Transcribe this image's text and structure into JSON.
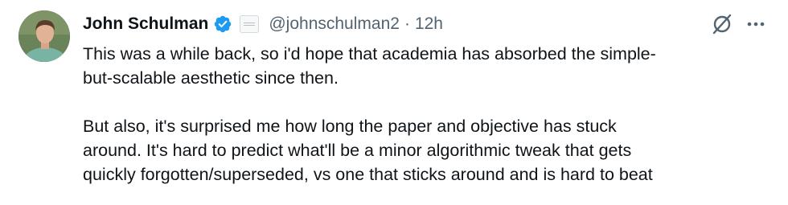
{
  "author": {
    "name": "John Schulman",
    "handle": "@johnschulman2",
    "separator": "·",
    "timestamp": "12h",
    "verified": true,
    "avatar_icon": "profile-photo"
  },
  "actions": {
    "grok_icon": "grok-icon",
    "more_icon": "more-options-icon"
  },
  "tweet": {
    "paragraphs": [
      "This was a while back, so i'd hope that academia has absorbed the simple-\nbut-scalable aesthetic since then.",
      "But also, it's surprised me how long the paper and objective has stuck\naround. It's hard to predict what'll be a minor algorithmic tweak that gets\nquickly forgotten/superseded, vs one that sticks around and is hard to beat"
    ]
  },
  "colors": {
    "text": "#0f1419",
    "secondary_text": "#536471",
    "verified_blue": "#1d9bf0"
  }
}
